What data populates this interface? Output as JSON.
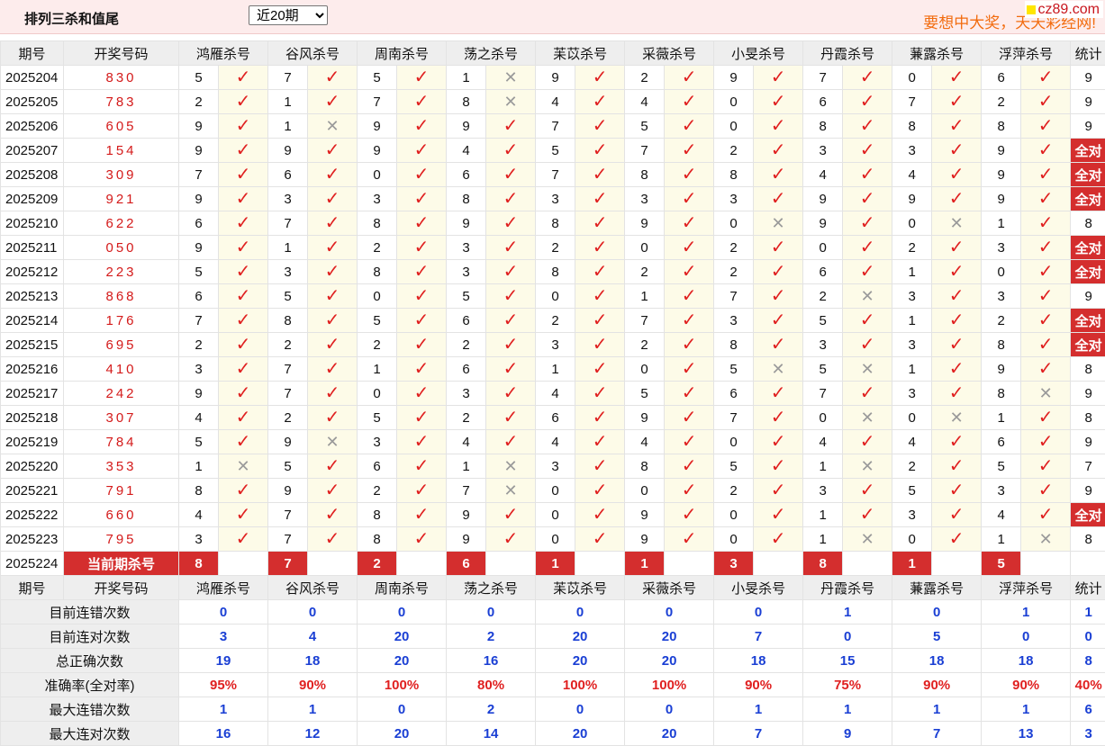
{
  "header": {
    "title": "排列三杀和值尾",
    "period_select": "近20期",
    "slogan": "要想中大奖，天天彩经网!",
    "brand": "cz89.com"
  },
  "columns": {
    "issue": "期号",
    "draw": "开奖号码",
    "experts": [
      "鸿雁杀号",
      "谷风杀号",
      "周南杀号",
      "荡之杀号",
      "苿苡杀号",
      "采薇杀号",
      "小旻杀号",
      "丹霞杀号",
      "蒹露杀号",
      "浮萍杀号"
    ],
    "total": "统计"
  },
  "rows": [
    {
      "issue": "2025204",
      "draw": "830",
      "picks": [
        [
          "5",
          1
        ],
        [
          "7",
          1
        ],
        [
          "5",
          1
        ],
        [
          "1",
          0
        ],
        [
          "9",
          1
        ],
        [
          "2",
          1
        ],
        [
          "9",
          1
        ],
        [
          "7",
          1
        ],
        [
          "0",
          1
        ],
        [
          "6",
          1
        ]
      ],
      "total": "9"
    },
    {
      "issue": "2025205",
      "draw": "783",
      "picks": [
        [
          "2",
          1
        ],
        [
          "1",
          1
        ],
        [
          "7",
          1
        ],
        [
          "8",
          0
        ],
        [
          "4",
          1
        ],
        [
          "4",
          1
        ],
        [
          "0",
          1
        ],
        [
          "6",
          1
        ],
        [
          "7",
          1
        ],
        [
          "2",
          1
        ]
      ],
      "total": "9"
    },
    {
      "issue": "2025206",
      "draw": "605",
      "picks": [
        [
          "9",
          1
        ],
        [
          "1",
          0
        ],
        [
          "9",
          1
        ],
        [
          "9",
          1
        ],
        [
          "7",
          1
        ],
        [
          "5",
          1
        ],
        [
          "0",
          1
        ],
        [
          "8",
          1
        ],
        [
          "8",
          1
        ],
        [
          "8",
          1
        ]
      ],
      "total": "9"
    },
    {
      "issue": "2025207",
      "draw": "154",
      "picks": [
        [
          "9",
          1
        ],
        [
          "9",
          1
        ],
        [
          "9",
          1
        ],
        [
          "4",
          1
        ],
        [
          "5",
          1
        ],
        [
          "7",
          1
        ],
        [
          "2",
          1
        ],
        [
          "3",
          1
        ],
        [
          "3",
          1
        ],
        [
          "9",
          1
        ]
      ],
      "total": "全对"
    },
    {
      "issue": "2025208",
      "draw": "309",
      "picks": [
        [
          "7",
          1
        ],
        [
          "6",
          1
        ],
        [
          "0",
          1
        ],
        [
          "6",
          1
        ],
        [
          "7",
          1
        ],
        [
          "8",
          1
        ],
        [
          "8",
          1
        ],
        [
          "4",
          1
        ],
        [
          "4",
          1
        ],
        [
          "9",
          1
        ]
      ],
      "total": "全对"
    },
    {
      "issue": "2025209",
      "draw": "921",
      "picks": [
        [
          "9",
          1
        ],
        [
          "3",
          1
        ],
        [
          "3",
          1
        ],
        [
          "8",
          1
        ],
        [
          "3",
          1
        ],
        [
          "3",
          1
        ],
        [
          "3",
          1
        ],
        [
          "9",
          1
        ],
        [
          "9",
          1
        ],
        [
          "9",
          1
        ]
      ],
      "total": "全对"
    },
    {
      "issue": "2025210",
      "draw": "622",
      "picks": [
        [
          "6",
          1
        ],
        [
          "7",
          1
        ],
        [
          "8",
          1
        ],
        [
          "9",
          1
        ],
        [
          "8",
          1
        ],
        [
          "9",
          1
        ],
        [
          "0",
          0
        ],
        [
          "9",
          1
        ],
        [
          "0",
          0
        ],
        [
          "1",
          1
        ]
      ],
      "total": "8"
    },
    {
      "issue": "2025211",
      "draw": "050",
      "picks": [
        [
          "9",
          1
        ],
        [
          "1",
          1
        ],
        [
          "2",
          1
        ],
        [
          "3",
          1
        ],
        [
          "2",
          1
        ],
        [
          "0",
          1
        ],
        [
          "2",
          1
        ],
        [
          "0",
          1
        ],
        [
          "2",
          1
        ],
        [
          "3",
          1
        ]
      ],
      "total": "全对"
    },
    {
      "issue": "2025212",
      "draw": "223",
      "picks": [
        [
          "5",
          1
        ],
        [
          "3",
          1
        ],
        [
          "8",
          1
        ],
        [
          "3",
          1
        ],
        [
          "8",
          1
        ],
        [
          "2",
          1
        ],
        [
          "2",
          1
        ],
        [
          "6",
          1
        ],
        [
          "1",
          1
        ],
        [
          "0",
          1
        ]
      ],
      "total": "全对"
    },
    {
      "issue": "2025213",
      "draw": "868",
      "picks": [
        [
          "6",
          1
        ],
        [
          "5",
          1
        ],
        [
          "0",
          1
        ],
        [
          "5",
          1
        ],
        [
          "0",
          1
        ],
        [
          "1",
          1
        ],
        [
          "7",
          1
        ],
        [
          "2",
          0
        ],
        [
          "3",
          1
        ],
        [
          "3",
          1
        ]
      ],
      "total": "9"
    },
    {
      "issue": "2025214",
      "draw": "176",
      "picks": [
        [
          "7",
          1
        ],
        [
          "8",
          1
        ],
        [
          "5",
          1
        ],
        [
          "6",
          1
        ],
        [
          "2",
          1
        ],
        [
          "7",
          1
        ],
        [
          "3",
          1
        ],
        [
          "5",
          1
        ],
        [
          "1",
          1
        ],
        [
          "2",
          1
        ]
      ],
      "total": "全对"
    },
    {
      "issue": "2025215",
      "draw": "695",
      "picks": [
        [
          "2",
          1
        ],
        [
          "2",
          1
        ],
        [
          "2",
          1
        ],
        [
          "2",
          1
        ],
        [
          "3",
          1
        ],
        [
          "2",
          1
        ],
        [
          "8",
          1
        ],
        [
          "3",
          1
        ],
        [
          "3",
          1
        ],
        [
          "8",
          1
        ]
      ],
      "total": "全对"
    },
    {
      "issue": "2025216",
      "draw": "410",
      "picks": [
        [
          "3",
          1
        ],
        [
          "7",
          1
        ],
        [
          "1",
          1
        ],
        [
          "6",
          1
        ],
        [
          "1",
          1
        ],
        [
          "0",
          1
        ],
        [
          "5",
          0
        ],
        [
          "5",
          0
        ],
        [
          "1",
          1
        ],
        [
          "9",
          1
        ]
      ],
      "total": "8"
    },
    {
      "issue": "2025217",
      "draw": "242",
      "picks": [
        [
          "9",
          1
        ],
        [
          "7",
          1
        ],
        [
          "0",
          1
        ],
        [
          "3",
          1
        ],
        [
          "4",
          1
        ],
        [
          "5",
          1
        ],
        [
          "6",
          1
        ],
        [
          "7",
          1
        ],
        [
          "3",
          1
        ],
        [
          "8",
          0
        ]
      ],
      "total": "9"
    },
    {
      "issue": "2025218",
      "draw": "307",
      "picks": [
        [
          "4",
          1
        ],
        [
          "2",
          1
        ],
        [
          "5",
          1
        ],
        [
          "2",
          1
        ],
        [
          "6",
          1
        ],
        [
          "9",
          1
        ],
        [
          "7",
          1
        ],
        [
          "0",
          0
        ],
        [
          "0",
          0
        ],
        [
          "1",
          1
        ]
      ],
      "total": "8"
    },
    {
      "issue": "2025219",
      "draw": "784",
      "picks": [
        [
          "5",
          1
        ],
        [
          "9",
          0
        ],
        [
          "3",
          1
        ],
        [
          "4",
          1
        ],
        [
          "4",
          1
        ],
        [
          "4",
          1
        ],
        [
          "0",
          1
        ],
        [
          "4",
          1
        ],
        [
          "4",
          1
        ],
        [
          "6",
          1
        ]
      ],
      "total": "9"
    },
    {
      "issue": "2025220",
      "draw": "353",
      "picks": [
        [
          "1",
          0
        ],
        [
          "5",
          1
        ],
        [
          "6",
          1
        ],
        [
          "1",
          0
        ],
        [
          "3",
          1
        ],
        [
          "8",
          1
        ],
        [
          "5",
          1
        ],
        [
          "1",
          0
        ],
        [
          "2",
          1
        ],
        [
          "5",
          1
        ]
      ],
      "total": "7"
    },
    {
      "issue": "2025221",
      "draw": "791",
      "picks": [
        [
          "8",
          1
        ],
        [
          "9",
          1
        ],
        [
          "2",
          1
        ],
        [
          "7",
          0
        ],
        [
          "0",
          1
        ],
        [
          "0",
          1
        ],
        [
          "2",
          1
        ],
        [
          "3",
          1
        ],
        [
          "5",
          1
        ],
        [
          "3",
          1
        ]
      ],
      "total": "9"
    },
    {
      "issue": "2025222",
      "draw": "660",
      "picks": [
        [
          "4",
          1
        ],
        [
          "7",
          1
        ],
        [
          "8",
          1
        ],
        [
          "9",
          1
        ],
        [
          "0",
          1
        ],
        [
          "9",
          1
        ],
        [
          "0",
          1
        ],
        [
          "1",
          1
        ],
        [
          "3",
          1
        ],
        [
          "4",
          1
        ]
      ],
      "total": "全对"
    },
    {
      "issue": "2025223",
      "draw": "795",
      "picks": [
        [
          "3",
          1
        ],
        [
          "7",
          1
        ],
        [
          "8",
          1
        ],
        [
          "9",
          1
        ],
        [
          "0",
          1
        ],
        [
          "9",
          1
        ],
        [
          "0",
          1
        ],
        [
          "1",
          0
        ],
        [
          "0",
          1
        ],
        [
          "1",
          0
        ]
      ],
      "total": "8"
    }
  ],
  "current": {
    "issue": "2025224",
    "label": "当前期杀号",
    "kills": [
      "8",
      "7",
      "2",
      "6",
      "1",
      "1",
      "3",
      "8",
      "1",
      "5"
    ]
  },
  "stats": [
    {
      "label": "目前连错次数",
      "values": [
        "0",
        "0",
        "0",
        "0",
        "0",
        "0",
        "0",
        "1",
        "0",
        "1"
      ],
      "total": "1"
    },
    {
      "label": "目前连对次数",
      "values": [
        "3",
        "4",
        "20",
        "2",
        "20",
        "20",
        "7",
        "0",
        "5",
        "0"
      ],
      "total": "0"
    },
    {
      "label": "总正确次数",
      "values": [
        "19",
        "18",
        "20",
        "16",
        "20",
        "20",
        "18",
        "15",
        "18",
        "18"
      ],
      "total": "8"
    },
    {
      "label": "准确率(全对率)",
      "values": [
        "95%",
        "90%",
        "100%",
        "80%",
        "100%",
        "100%",
        "90%",
        "75%",
        "90%",
        "90%"
      ],
      "total": "40%",
      "pct": true
    },
    {
      "label": "最大连错次数",
      "values": [
        "1",
        "1",
        "0",
        "2",
        "0",
        "0",
        "1",
        "1",
        "1",
        "1"
      ],
      "total": "6"
    },
    {
      "label": "最大连对次数",
      "values": [
        "16",
        "12",
        "20",
        "14",
        "20",
        "20",
        "7",
        "9",
        "7",
        "13"
      ],
      "total": "3"
    }
  ],
  "icons": {
    "hit": "check-icon",
    "miss": "cross-icon"
  },
  "colors": {
    "accent_red": "#d42e2e",
    "check_red": "#e02020",
    "stat_blue": "#1a3fd4",
    "header_bg": "#fdecec",
    "slogan_orange": "#f26c0f"
  }
}
